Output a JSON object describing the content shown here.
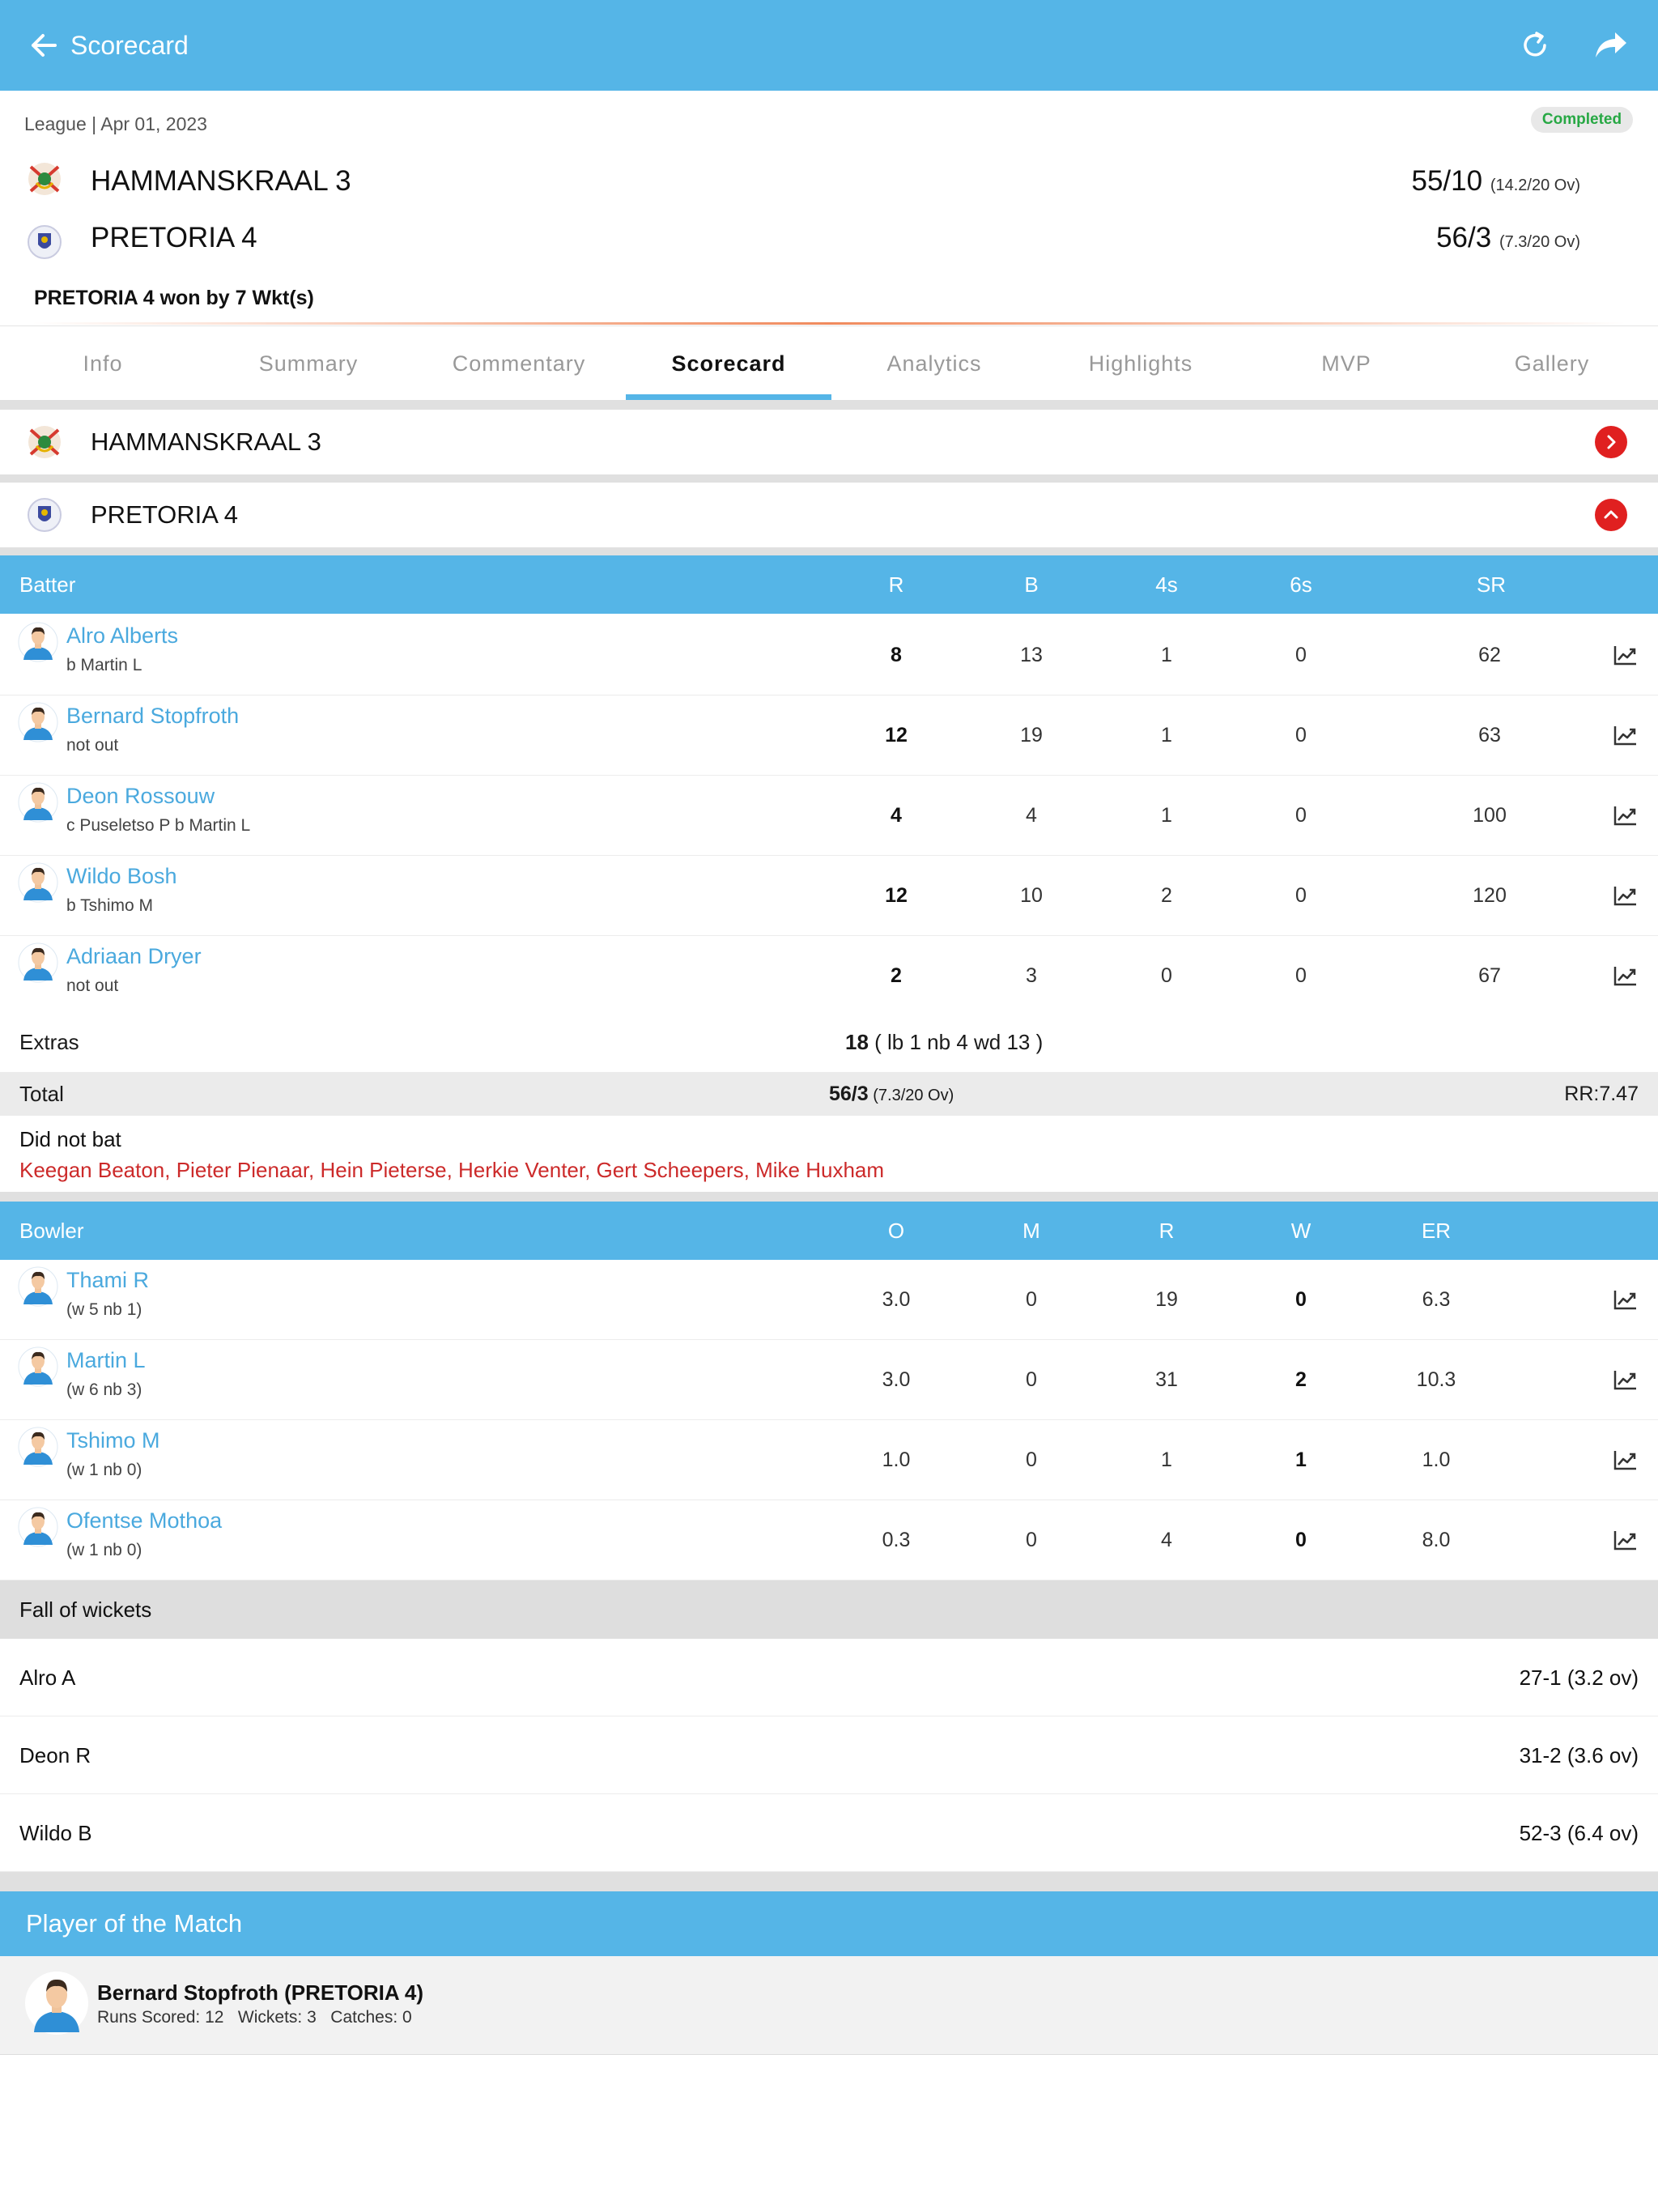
{
  "appbar": {
    "title": "Scorecard"
  },
  "match": {
    "meta": "League | Apr 01, 2023",
    "status": "Completed",
    "teams": [
      {
        "name": "HAMMANSKRAAL 3",
        "score": "55/10",
        "overs": "(14.2/20 Ov)"
      },
      {
        "name": "PRETORIA 4",
        "score": "56/3",
        "overs": "(7.3/20 Ov)"
      }
    ],
    "result": "PRETORIA 4 won by 7 Wkt(s)"
  },
  "tabs": [
    "Info",
    "Summary",
    "Commentary",
    "Scorecard",
    "Analytics",
    "Highlights",
    "MVP",
    "Gallery"
  ],
  "active_tab": "Scorecard",
  "innings": [
    {
      "team": "HAMMANSKRAAL 3",
      "expanded": false
    },
    {
      "team": "PRETORIA 4",
      "expanded": true
    }
  ],
  "batting": {
    "headers": {
      "batter": "Batter",
      "r": "R",
      "b": "B",
      "fours": "4s",
      "sixes": "6s",
      "sr": "SR"
    },
    "rows": [
      {
        "name": "Alro Alberts",
        "dismissal": "b Martin L",
        "r": "8",
        "b": "13",
        "fours": "1",
        "sixes": "0",
        "sr": "62"
      },
      {
        "name": "Bernard Stopfroth",
        "dismissal": "not out",
        "r": "12",
        "b": "19",
        "fours": "1",
        "sixes": "0",
        "sr": "63"
      },
      {
        "name": "Deon Rossouw",
        "dismissal": "c Puseletso P b Martin L",
        "r": "4",
        "b": "4",
        "fours": "1",
        "sixes": "0",
        "sr": "100"
      },
      {
        "name": "Wildo Bosh",
        "dismissal": "b Tshimo M",
        "r": "12",
        "b": "10",
        "fours": "2",
        "sixes": "0",
        "sr": "120"
      },
      {
        "name": "Adriaan Dryer",
        "dismissal": "not out",
        "r": "2",
        "b": "3",
        "fours": "0",
        "sixes": "0",
        "sr": "67"
      }
    ],
    "extras_label": "Extras",
    "extras_total": "18",
    "extras_detail": " ( lb 1 nb 4 wd 13 )",
    "total_label": "Total",
    "total_score": "56/3",
    "total_overs": " (7.3/20 Ov)",
    "run_rate": "RR:7.47",
    "did_not_bat_label": "Did not bat",
    "did_not_bat": "Keegan Beaton, Pieter Pienaar, Hein Pieterse, Herkie Venter, Gert Scheepers, Mike Huxham"
  },
  "bowling": {
    "headers": {
      "bowler": "Bowler",
      "o": "O",
      "m": "M",
      "r": "R",
      "w": "W",
      "er": "ER"
    },
    "rows": [
      {
        "name": "Thami R",
        "extras": "(w 5 nb 1)",
        "o": "3.0",
        "m": "0",
        "r": "19",
        "w": "0",
        "er": "6.3"
      },
      {
        "name": "Martin L",
        "extras": "(w 6 nb 3)",
        "o": "3.0",
        "m": "0",
        "r": "31",
        "w": "2",
        "er": "10.3"
      },
      {
        "name": "Tshimo M",
        "extras": "(w 1 nb 0)",
        "o": "1.0",
        "m": "0",
        "r": "1",
        "w": "1",
        "er": "1.0"
      },
      {
        "name": "Ofentse Mothoa",
        "extras": "(w 1 nb 0)",
        "o": "0.3",
        "m": "0",
        "r": "4",
        "w": "0",
        "er": "8.0"
      }
    ]
  },
  "fall_of_wickets": {
    "title": "Fall of wickets",
    "rows": [
      {
        "name": "Alro A",
        "value": "27-1 (3.2 ov)"
      },
      {
        "name": "Deon R",
        "value": "31-2 (3.6 ov)"
      },
      {
        "name": "Wildo B",
        "value": "52-3 (6.4 ov)"
      }
    ]
  },
  "player_of_match": {
    "title": "Player of the Match",
    "name": "Bernard Stopfroth (PRETORIA 4)",
    "stats": "Runs Scored: 12   Wickets: 3   Catches: 0"
  },
  "colors": {
    "primary": "#55b5e7",
    "accent_red": "#e02020",
    "link_blue": "#4aa9de",
    "success": "#27a844"
  },
  "icons": [
    "back-arrow-icon",
    "refresh-icon",
    "share-icon",
    "chevron-right-icon",
    "chevron-up-icon",
    "chart-icon",
    "player-avatar-icon",
    "team-logo-icon"
  ]
}
